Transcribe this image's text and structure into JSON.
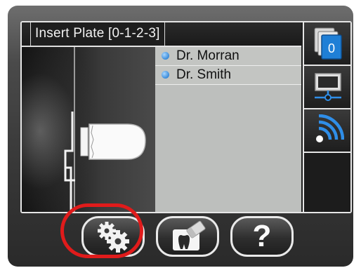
{
  "header": {
    "title": "Insert Plate [0-1-2-3]"
  },
  "patients": [
    {
      "name": "Dr. Morran"
    },
    {
      "name": "Dr. Smith"
    }
  ],
  "sidebar": {
    "badge_count": "0",
    "items": [
      {
        "icon": "plates-stack-icon"
      },
      {
        "icon": "monitor-icon"
      },
      {
        "icon": "wireless-icon"
      }
    ]
  },
  "toolbar": {
    "settings_icon": "gears-icon",
    "erase_icon": "tooth-eraser-icon",
    "help_label": "?"
  },
  "colors": {
    "highlight": "#e01b1b",
    "accent_blue": "#3a8ad8",
    "list_bg": "#bdbfbd"
  }
}
